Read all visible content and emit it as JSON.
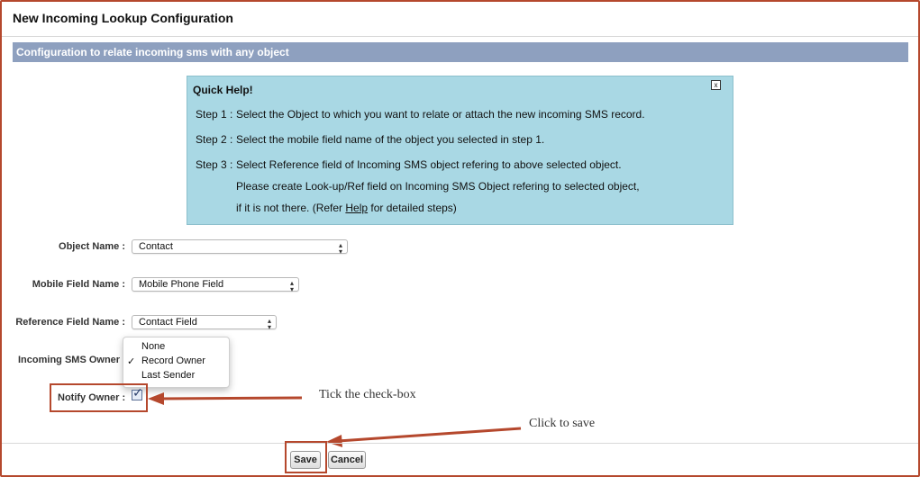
{
  "page": {
    "title": "New Incoming Lookup Configuration"
  },
  "section": {
    "header": "Configuration to relate incoming sms with any object"
  },
  "quick_help": {
    "title": "Quick Help!",
    "close_label": "x",
    "steps": [
      {
        "label": "Step 1 :",
        "text": "Select the Object to which you want to relate or attach the new incoming SMS record."
      },
      {
        "label": "Step 2 :",
        "text": "Select the mobile field name of the object you selected in step 1."
      },
      {
        "label": "Step 3 :",
        "text": "Select Reference field of Incoming SMS object refering to above selected object."
      }
    ],
    "step3_line2": "Please create Look-up/Ref field on Incoming SMS Object refering to selected object,",
    "step3_line3_prefix": "if it is not there. (Refer ",
    "step3_line3_link": "Help",
    "step3_line3_suffix": " for detailed steps)"
  },
  "form": {
    "object_name": {
      "label": "Object Name :",
      "value": "Contact"
    },
    "mobile_field_name": {
      "label": "Mobile Field Name :",
      "value": "Mobile Phone Field"
    },
    "reference_field_name": {
      "label": "Reference Field Name :",
      "value": "Contact Field"
    },
    "incoming_sms_owner": {
      "label": "Incoming SMS Owner",
      "options": [
        "None",
        "Record Owner",
        "Last Sender"
      ],
      "selected": "Record Owner",
      "check_glyph": "✓"
    },
    "notify_owner": {
      "label": "Notify Owner :",
      "checked": true
    }
  },
  "annotations": {
    "tick_checkbox": "Tick the check-box",
    "click_to_save": "Click to save"
  },
  "buttons": {
    "save": "Save",
    "cancel": "Cancel"
  },
  "colors": {
    "highlight": "#b5482d",
    "section_header": "#8ea0bf",
    "quick_help_bg": "#a9d8e4"
  }
}
